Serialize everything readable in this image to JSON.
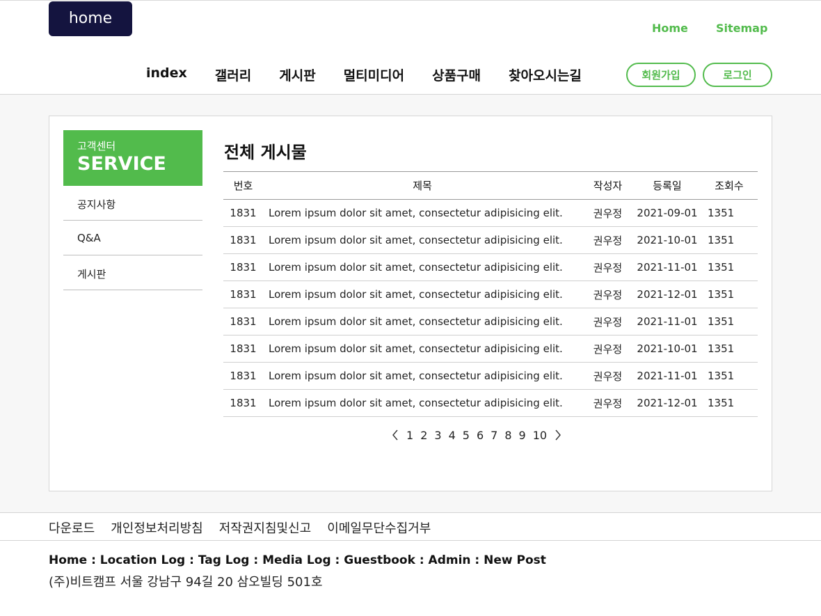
{
  "header": {
    "logo_text": "home",
    "util_links": [
      "Home",
      "Sitemap"
    ],
    "nav": [
      "index",
      "갤러리",
      "게시판",
      "멀티미디어",
      "상품구매",
      "찾아오시는길"
    ],
    "join_label": "회원가입",
    "login_label": "로그인"
  },
  "sidebar": {
    "subtitle": "고객센터",
    "title": "SERVICE",
    "items": [
      "공지사항",
      "Q&A",
      "게시판"
    ]
  },
  "board": {
    "title": "전체 게시물",
    "columns": [
      "번호",
      "제목",
      "작성자",
      "등록일",
      "조회수"
    ],
    "rows": [
      {
        "no": "1831",
        "title": "Lorem ipsum dolor sit amet, consectetur adipisicing elit.",
        "author": "권우정",
        "date": "2021-09-01",
        "views": "1351"
      },
      {
        "no": "1831",
        "title": "Lorem ipsum dolor sit amet, consectetur adipisicing elit.",
        "author": "권우정",
        "date": "2021-10-01",
        "views": "1351"
      },
      {
        "no": "1831",
        "title": "Lorem ipsum dolor sit amet, consectetur adipisicing elit.",
        "author": "권우정",
        "date": "2021-11-01",
        "views": "1351"
      },
      {
        "no": "1831",
        "title": "Lorem ipsum dolor sit amet, consectetur adipisicing elit.",
        "author": "권우정",
        "date": "2021-12-01",
        "views": "1351"
      },
      {
        "no": "1831",
        "title": "Lorem ipsum dolor sit amet, consectetur adipisicing elit.",
        "author": "권우정",
        "date": "2021-11-01",
        "views": "1351"
      },
      {
        "no": "1831",
        "title": "Lorem ipsum dolor sit amet, consectetur adipisicing elit.",
        "author": "권우정",
        "date": "2021-10-01",
        "views": "1351"
      },
      {
        "no": "1831",
        "title": "Lorem ipsum dolor sit amet, consectetur adipisicing elit.",
        "author": "권우정",
        "date": "2021-11-01",
        "views": "1351"
      },
      {
        "no": "1831",
        "title": "Lorem ipsum dolor sit amet, consectetur adipisicing elit.",
        "author": "권우정",
        "date": "2021-12-01",
        "views": "1351"
      }
    ],
    "pages": [
      "1",
      "2",
      "3",
      "4",
      "5",
      "6",
      "7",
      "8",
      "9",
      "10"
    ]
  },
  "footer": {
    "links": [
      "다운로드",
      "개인정보처리방침",
      "저작권지침및신고",
      "이메일무단수집거부"
    ],
    "nav_text": "Home : Location Log : Tag Log : Media Log : Guestbook : Admin : New Post",
    "address": "(주)비트캠프 서울 강남구 94길 20 삼오빌딩 501호"
  },
  "colors": {
    "accent": "#52bb4c",
    "logo_bg": "#14143f"
  }
}
